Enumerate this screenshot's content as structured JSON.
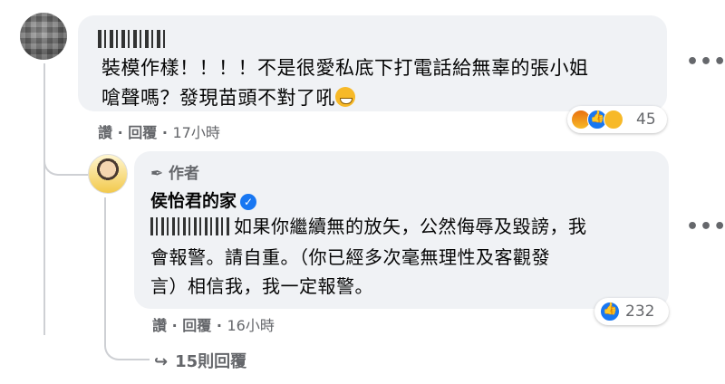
{
  "comment1": {
    "line1": "裝模作樣！！！！不是很愛私底下打電話給無辜的張小姐",
    "line2": "嗆聲嗎？發現苗頭不對了吼",
    "actions": {
      "like": "讚",
      "reply": "回覆",
      "time": "17小時"
    },
    "reaction_icons": [
      "angry-icon",
      "like-icon",
      "haha-icon"
    ],
    "reaction_count": "45"
  },
  "reply1": {
    "author_tag": "作者",
    "page_name": "侯怡君的家",
    "line1": "如果你繼續無的放矢，公然侮辱及毀謗，我",
    "line2": "會報警。請自重。（你已經多次毫無理性及客觀發",
    "line3": "言）相信我，我一定報警。",
    "actions": {
      "like": "讚",
      "reply": "回覆",
      "time": "16小時"
    },
    "reaction_count": "232"
  },
  "more_replies": {
    "label": "15則回覆"
  },
  "colors": {
    "bubble": "#f0f2f5",
    "meta_text": "#65676b",
    "fb_blue": "#1877f2"
  }
}
